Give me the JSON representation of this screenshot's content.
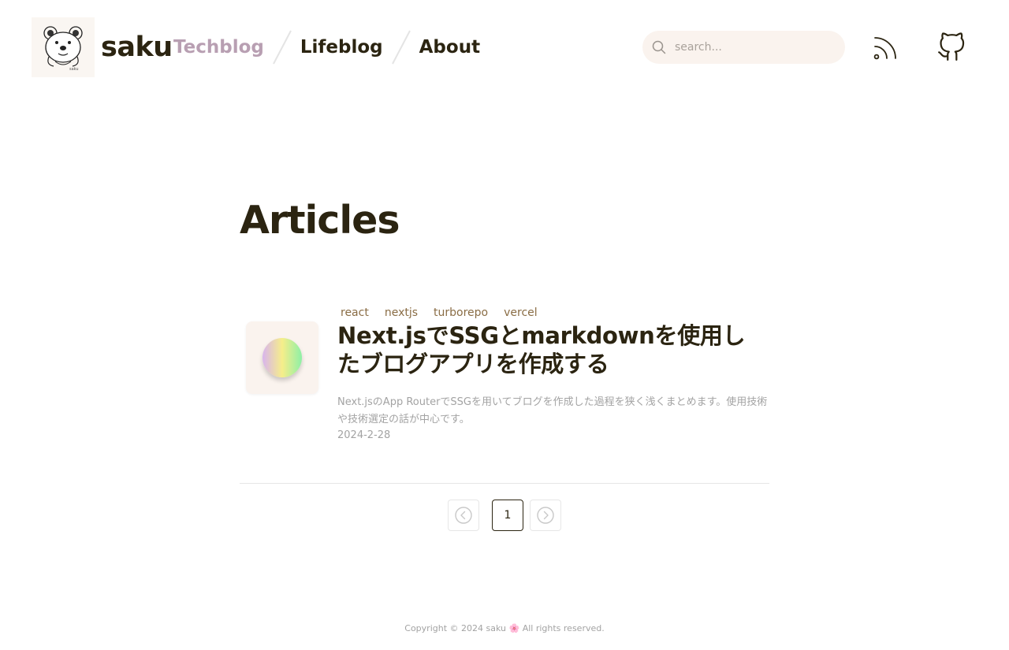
{
  "header": {
    "site_name": "saku",
    "nav": [
      {
        "label": "Techblog",
        "active": true
      },
      {
        "label": "Lifeblog",
        "active": false
      },
      {
        "label": "About",
        "active": false
      }
    ],
    "search": {
      "placeholder": "search...",
      "value": ""
    },
    "icons": {
      "search": "search-icon",
      "rss": "rss-icon",
      "github": "github-icon"
    }
  },
  "main": {
    "title": "Articles",
    "articles": [
      {
        "tags": [
          "react",
          "nextjs",
          "turborepo",
          "vercel"
        ],
        "title": "Next.jsでSSGとmarkdownを使用したブログアプリを作成する",
        "description": "Next.jsのApp RouterでSSGを用いてブログを作成した過程を狭く浅くまとめます。使用技術や技術選定の話が中心です。",
        "date": "2024-2-28"
      }
    ],
    "pagination": {
      "current_page": "1"
    }
  },
  "footer": {
    "text_before": "Copyright © 2024 saku",
    "text_after": "All rights reserved."
  },
  "colors": {
    "text": "#2b2411",
    "active_nav": "#b89fb2",
    "tag": "#8a6d45",
    "muted": "#a3a3a3",
    "search_bg": "#faf3ee"
  }
}
